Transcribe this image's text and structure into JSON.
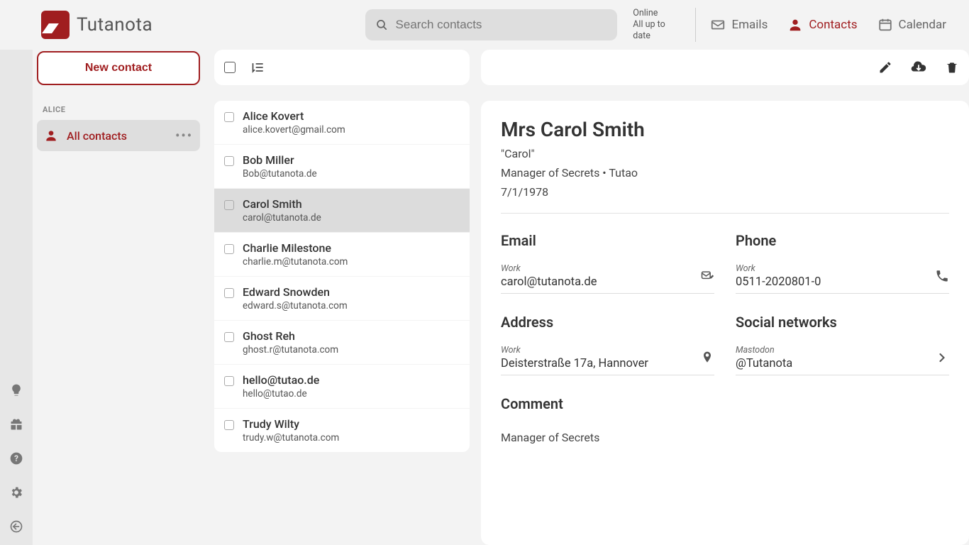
{
  "brand": "Tutanota",
  "search": {
    "placeholder": "Search contacts"
  },
  "status": {
    "line1": "Online",
    "line2": "All up to date"
  },
  "nav": {
    "emails": "Emails",
    "contacts": "Contacts",
    "calendar": "Calendar"
  },
  "sidebar": {
    "new_button": "New contact",
    "owner_label": "ALICE",
    "all_contacts": "All contacts"
  },
  "contacts": [
    {
      "name": "Alice Kovert",
      "email": "alice.kovert@gmail.com"
    },
    {
      "name": "Bob Miller",
      "email": "Bob@tutanota.de"
    },
    {
      "name": "Carol Smith",
      "email": "carol@tutanota.de",
      "selected": true
    },
    {
      "name": "Charlie Milestone",
      "email": "charlie.m@tutanota.com"
    },
    {
      "name": "Edward Snowden",
      "email": "edward.s@tutanota.com"
    },
    {
      "name": "Ghost Reh",
      "email": "ghost.r@tutanota.com"
    },
    {
      "name": "hello@tutao.de",
      "email": "hello@tutao.de"
    },
    {
      "name": "Trudy Wilty",
      "email": "trudy.w@tutanota.com"
    }
  ],
  "detail": {
    "title": "Mrs Carol Smith",
    "nickname": "\"Carol\"",
    "role_line": "Manager of Secrets  •  Tutao",
    "birthday": "7/1/1978",
    "sections": {
      "email_heading": "Email",
      "phone_heading": "Phone",
      "address_heading": "Address",
      "social_heading": "Social networks",
      "comment_heading": "Comment"
    },
    "email": {
      "label": "Work",
      "value": "carol@tutanota.de"
    },
    "phone": {
      "label": "Work",
      "value": "0511-2020801-0"
    },
    "address": {
      "label": "Work",
      "value": "Deisterstraße 17a, Hannover"
    },
    "social": {
      "label": "Mastodon",
      "value": "@Tutanota"
    },
    "comment": "Manager of Secrets"
  }
}
